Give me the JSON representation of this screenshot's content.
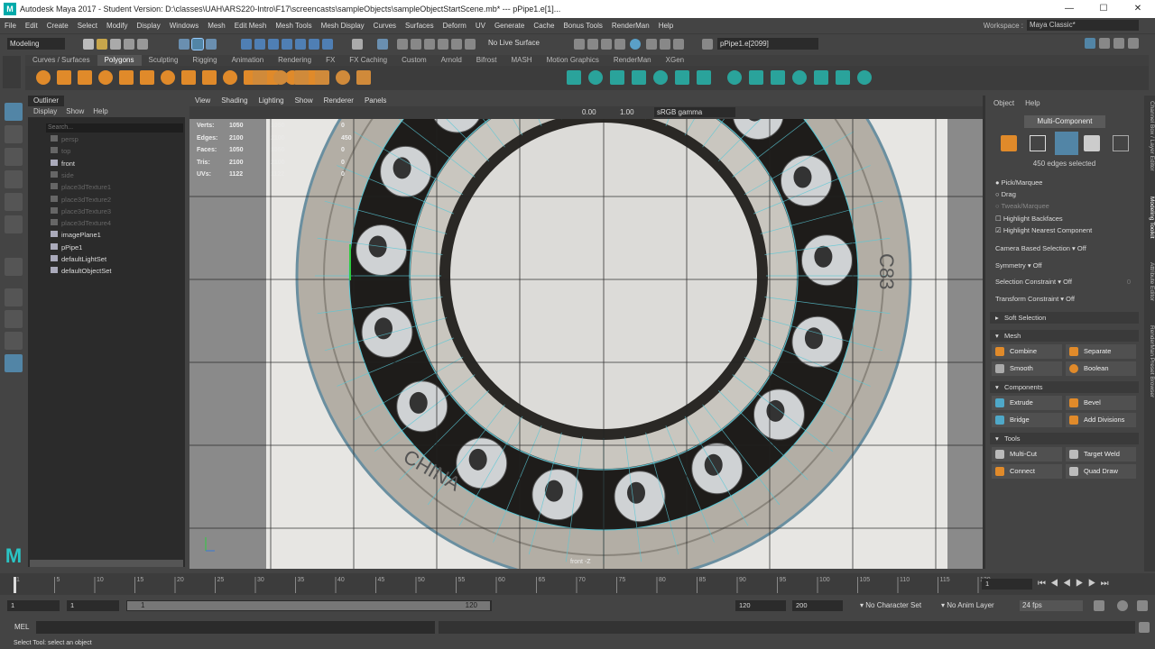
{
  "window": {
    "title": "Autodesk Maya 2017 - Student Version: D:\\classes\\UAH\\ARS220-Intro\\F17\\screencasts\\sampleObjects\\sampleObjectStartScene.mb*  ---  pPipe1.e[1]...",
    "min": "—",
    "max": "☐",
    "close": "✕"
  },
  "menus": [
    "File",
    "Edit",
    "Create",
    "Select",
    "Modify",
    "Display",
    "Windows",
    "Mesh",
    "Edit Mesh",
    "Mesh Tools",
    "Mesh Display",
    "Curves",
    "Surfaces",
    "Deform",
    "UV",
    "Generate",
    "Cache",
    "Bonus Tools",
    "RenderMan",
    "Help"
  ],
  "workspace": {
    "label": "Workspace :",
    "value": "Maya Classic*"
  },
  "status": {
    "mode": "Modeling",
    "live_surface": "No Live Surface",
    "object_field": "pPipe1.e[2099]"
  },
  "shelf_tabs": [
    "Curves / Surfaces",
    "Polygons",
    "Sculpting",
    "Rigging",
    "Animation",
    "Rendering",
    "FX",
    "FX Caching",
    "Custom",
    "Arnold",
    "Bifrost",
    "MASH",
    "Motion Graphics",
    "RenderMan",
    "XGen"
  ],
  "shelf_active": "Polygons",
  "outliner": {
    "tab": "Outliner",
    "menu": [
      "Display",
      "Show",
      "Help"
    ],
    "search_placeholder": "Search...",
    "items": [
      "persp",
      "top",
      "front",
      "side",
      "place3dTexture1",
      "place3dTexture2",
      "place3dTexture3",
      "place3dTexture4",
      "imagePlane1",
      "pPipe1",
      "defaultLightSet",
      "defaultObjectSet"
    ]
  },
  "viewport": {
    "menu": [
      "View",
      "Shading",
      "Lighting",
      "Show",
      "Renderer",
      "Panels"
    ],
    "exposure": "0.00",
    "gamma": "1.00",
    "colorspace": "sRGB gamma",
    "camera_label": "front -Z",
    "hud": [
      {
        "label": "Verts:",
        "a": "1050",
        "b": "1050",
        "c": "0"
      },
      {
        "label": "Edges:",
        "a": "2100",
        "b": "2100",
        "c": "450"
      },
      {
        "label": "Faces:",
        "a": "1050",
        "b": "1050",
        "c": "0"
      },
      {
        "label": "Tris:",
        "a": "2100",
        "b": "2100",
        "c": "0"
      },
      {
        "label": "UVs:",
        "a": "1122",
        "b": "1122",
        "c": "0"
      }
    ],
    "bearing_text": [
      "C83",
      "CHINA"
    ]
  },
  "modeling": {
    "menu": [
      "Object",
      "Help"
    ],
    "mode_label": "Multi-Component",
    "selected": "450 edges selected",
    "options": {
      "pick": "Pick/Marquee",
      "drag": "Drag",
      "tweak": "Tweak/Marquee",
      "backfaces": "Highlight Backfaces",
      "nearest": "Highlight Nearest Component"
    },
    "camera_sel": {
      "label": "Camera Based Selection",
      "value": "Off"
    },
    "symmetry": {
      "label": "Symmetry",
      "value": "Off"
    },
    "sel_constraint": {
      "label": "Selection Constraint",
      "value": "Off",
      "num": "0"
    },
    "xform_constraint": {
      "label": "Transform Constraint",
      "value": "Off"
    },
    "soft_selection": "Soft Selection",
    "sections": {
      "mesh": "Mesh",
      "components": "Components",
      "tools": "Tools"
    },
    "buttons": {
      "combine": "Combine",
      "separate": "Separate",
      "smooth": "Smooth",
      "boolean": "Boolean",
      "extrude": "Extrude",
      "bevel": "Bevel",
      "bridge": "Bridge",
      "add_divisions": "Add Divisions",
      "multicut": "Multi-Cut",
      "target_weld": "Target Weld",
      "connect": "Connect",
      "quad_draw": "Quad Draw"
    }
  },
  "side_tabs": [
    "Channel Box / Layer Editor",
    "Modeling Toolkit",
    "Attribute Editor",
    "RenderMan Preset Browser"
  ],
  "timeline": {
    "ticks": [
      "1",
      "5",
      "10",
      "15",
      "20",
      "25",
      "30",
      "35",
      "40",
      "45",
      "50",
      "55",
      "60",
      "65",
      "70",
      "75",
      "80",
      "85",
      "90",
      "95",
      "100",
      "105",
      "110",
      "115",
      "120"
    ],
    "current": "1"
  },
  "range": {
    "start": "1",
    "start2": "1",
    "slider_start": "1",
    "slider_end": "120",
    "end": "120",
    "end2": "200",
    "char_set": "No Character Set",
    "anim_layer": "No Anim Layer",
    "fps": "24 fps"
  },
  "cmd": {
    "label": "MEL"
  },
  "help": "Select Tool: select an object",
  "colors": {
    "accent": "#5285a6",
    "wire": "#59c8d6"
  }
}
